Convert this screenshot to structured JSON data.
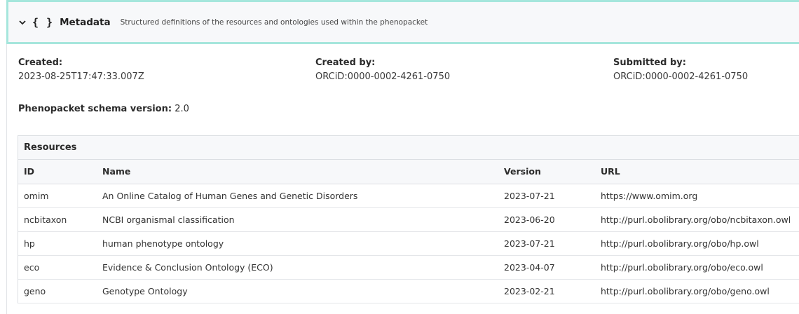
{
  "header": {
    "chevron_icon": "chevron-down-icon",
    "braces_icon": "{ }",
    "title": "Metadata",
    "subtitle": "Structured definitions of the resources and ontologies used within the phenopacket"
  },
  "meta": {
    "created_label": "Created:",
    "created_value": "2023-08-25T17:47:33.007Z",
    "created_by_label": "Created by:",
    "created_by_value": "ORCiD:0000-0002-4261-0750",
    "submitted_by_label": "Submitted by:",
    "submitted_by_value": "ORCiD:0000-0002-4261-0750",
    "schema_label": "Phenopacket schema version:",
    "schema_value": "2.0"
  },
  "resources": {
    "title": "Resources",
    "columns": [
      "ID",
      "Name",
      "Version",
      "URL"
    ],
    "rows": [
      [
        "omim",
        "An Online Catalog of Human Genes and Genetic Disorders",
        "2023-07-21",
        "https://www.omim.org"
      ],
      [
        "ncbitaxon",
        "NCBI organismal classification",
        "2023-06-20",
        "http://purl.obolibrary.org/obo/ncbitaxon.owl"
      ],
      [
        "hp",
        "human phenotype ontology",
        "2023-07-21",
        "http://purl.obolibrary.org/obo/hp.owl"
      ],
      [
        "eco",
        "Evidence & Conclusion Ontology (ECO)",
        "2023-04-07",
        "http://purl.obolibrary.org/obo/eco.owl"
      ],
      [
        "geno",
        "Genotype Ontology",
        "2023-02-21",
        "http://purl.obolibrary.org/obo/geno.owl"
      ]
    ]
  }
}
